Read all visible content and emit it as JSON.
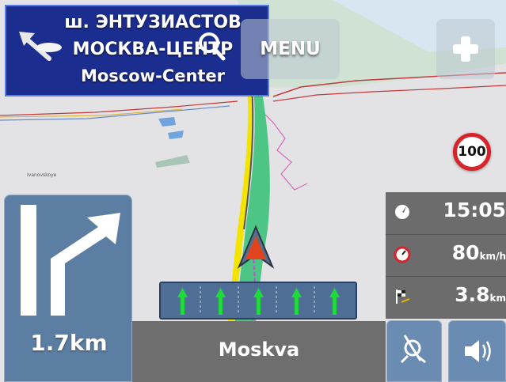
{
  "colors": {
    "sign_background": "#1b2d8e",
    "route_green": "#3cc27a",
    "route_yellow": "#f3e400",
    "route_line_purple": "#c050d0",
    "position_arrow": "#e0441c",
    "speed_limit_ring": "#d8232a",
    "panel_blue": "#5c7ea3",
    "panel_grey": "#6c6c6c"
  },
  "direction_sign": {
    "line1": "ш. ЭНТУЗИАСТОВ",
    "line2": "МОСКВА-ЦЕНТР",
    "line3": "Moscow-Center"
  },
  "toolbar": {
    "back_icon": "arrow-up-left-icon",
    "search_icon": "magnifier-icon",
    "menu_label": "MENU",
    "zoom_icon": "plus-icon"
  },
  "map": {
    "speed_limit": "100",
    "poi_label": "Ivanovskoye"
  },
  "maneuver": {
    "icon": "keep-right-arrow-icon",
    "distance": "1.7km"
  },
  "lane_guidance": {
    "lanes": [
      {
        "icon": "up-arrow-icon",
        "recommended": true
      },
      {
        "icon": "up-arrow-icon",
        "recommended": true
      },
      {
        "icon": "up-arrow-icon",
        "recommended": true
      },
      {
        "icon": "up-arrow-icon",
        "recommended": true
      },
      {
        "icon": "up-arrow-icon",
        "recommended": true
      }
    ]
  },
  "street": {
    "name": "Moskva"
  },
  "trip_info": {
    "arrival_time": "15:05",
    "speed_value": "80",
    "speed_unit": "km/h",
    "remaining_value": "3.8",
    "remaining_unit": "km"
  },
  "bottom_buttons": {
    "gps_icon": "satellite-icon",
    "sound_icon": "speaker-icon"
  }
}
